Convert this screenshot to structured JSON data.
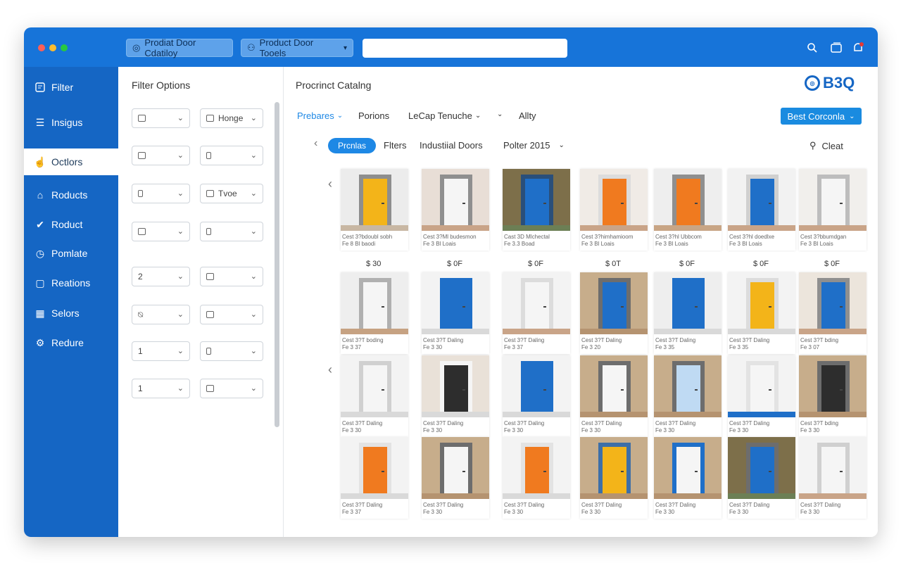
{
  "titlebar": {
    "tab1_label": "Prodiat Door Cdatiloy",
    "tab2_label": "Product Door Tooels",
    "search_value": ""
  },
  "sidebar": {
    "items": [
      {
        "label": "Filter",
        "icon": "filter-icon"
      },
      {
        "label": "Insigus",
        "icon": "list-icon"
      },
      {
        "label": "Octlors",
        "icon": "hand-icon"
      },
      {
        "label": "Roducts",
        "icon": "box-icon"
      },
      {
        "label": "Roduct",
        "icon": "check-icon"
      },
      {
        "label": "Pomlate",
        "icon": "circle-icon"
      },
      {
        "label": "Reations",
        "icon": "square-icon"
      },
      {
        "label": "Selors",
        "icon": "grid-icon"
      },
      {
        "label": "Redure",
        "icon": "gear-icon"
      }
    ],
    "active_index": 2
  },
  "filter_panel": {
    "title": "Filter Options",
    "rows": [
      {
        "left": "",
        "right": "Honge"
      },
      {
        "left": "",
        "right": ""
      },
      {
        "left": "",
        "right": "Tvoe"
      },
      {
        "left": "",
        "right": ""
      },
      {
        "left": "2",
        "right": ""
      },
      {
        "left": "",
        "right": ""
      },
      {
        "left": "1",
        "right": ""
      },
      {
        "left": "1",
        "right": ""
      }
    ]
  },
  "main": {
    "title": "Procrinct Catalng",
    "logo_text": "B3Q",
    "toolbar": {
      "pretares": "Prebares",
      "porions": "Porions",
      "lecap": "LeCap Tenuche",
      "ality": "Allty",
      "best_button": "Best Corconla"
    },
    "filters_row": {
      "pill": "Prcnlas",
      "filters": "Flters",
      "industrial": "Industiial Doors",
      "polter": "Polter 2015",
      "clear": "Cleat"
    },
    "prices_row1": [
      "$ 30",
      "$ 0F",
      "$ 0F",
      "$ 0T",
      "$ 0F",
      "$ 0F",
      "$ 0F"
    ],
    "cards": [
      [
        {
          "door": "#f3b419",
          "frame": "#8e8e8e",
          "wall": "#ececec",
          "floor": "#c8b7a3",
          "caption": "Cest 3?bdoubl sobh\nFe 8 Bl baodi"
        },
        {
          "door": "#f5f5f5",
          "frame": "#8f8f8f",
          "wall": "#e8ded6",
          "floor": "#c9a488",
          "caption": "Cest 3?Ml budesmon\nFe 3 Bl Loais"
        },
        {
          "door": "#1f6fc8",
          "frame": "#2a4f7a",
          "wall": "#7d6f4a",
          "floor": "#6c7f55",
          "caption": "Cast 3D Mlchectal\nFe 3.3 Boad"
        },
        {
          "door": "#f07a1f",
          "frame": "#dcdcdc",
          "wall": "#f0ebe6",
          "floor": "#c9a488",
          "caption": "Cest 3?himhamioom\nFe 3 Bl Loais"
        },
        {
          "door": "#f07a1f",
          "frame": "#8f8f8f",
          "wall": "#eeeeee",
          "floor": "#c8a585",
          "caption": "Cest 3?hl Ubbcom\nFe 3 Bl Loais"
        },
        {
          "door": "#1f6fc8",
          "frame": "#d0d0d0",
          "wall": "#f2f2f2",
          "floor": "#c9a488",
          "caption": "Cest 3?hl doedlxe\nFe 3 Bl Loais"
        },
        {
          "door": "#f5f5f5",
          "frame": "#bdbdbd",
          "wall": "#f1efec",
          "floor": "#c9a488",
          "caption": "Cest 3?bbumdgan\nFe 3 Bl Loais"
        }
      ],
      [
        {
          "door": "#f5f5f5",
          "frame": "#b0b0b0",
          "wall": "#eeeeee",
          "floor": "#c6a282",
          "caption": "Cest 3?T boding\nFe 3 37"
        },
        {
          "door": "#1f6fc8",
          "frame": "#1f6fc8",
          "wall": "#f3f3f3",
          "floor": "#d9d9d9",
          "caption": "Cest 3?T Daling\nFe 3 30"
        },
        {
          "door": "#f5f5f5",
          "frame": "#dcdcdc",
          "wall": "#f3f3f3",
          "floor": "#c9a488",
          "caption": "Cest 3?T Daling\nFe 3 37"
        },
        {
          "door": "#1f6fc8",
          "frame": "#6d6d6d",
          "wall": "#c7ad8b",
          "floor": "#b59370",
          "caption": "Cest 3?T Daling\nFe 3 20"
        },
        {
          "door": "#1f6fc8",
          "frame": "#1f6fc8",
          "wall": "#eeeeee",
          "floor": "#d9d9d9",
          "caption": "Cest 3?T Daling\nFe 3 35"
        },
        {
          "door": "#f3b419",
          "frame": "#dcdcdc",
          "wall": "#f3f3f3",
          "floor": "#d9d9d9",
          "caption": "Cest 3?T Daling\nFe 3 35"
        },
        {
          "door": "#1f6fc8",
          "frame": "#8f8f8f",
          "wall": "#ece5dc",
          "floor": "#c9a488",
          "caption": "Cest 3?T bding\nFe 3 07"
        }
      ],
      [
        {
          "door": "#f5f5f5",
          "frame": "#d0d0d0",
          "wall": "#f3f3f3",
          "floor": "#d9d9d9",
          "caption": "Cest 3?T Daling\nFe 3 30"
        },
        {
          "door": "#2d2d2d",
          "frame": "#f5f5f5",
          "wall": "#e9e1d8",
          "floor": "#d9d9d9",
          "caption": "Cest 3?T Daling\nFe 3 30"
        },
        {
          "door": "#1f6fc8",
          "frame": "#1f6fc8",
          "wall": "#f3f3f3",
          "floor": "#d9d9d9",
          "caption": "Cest 3?T Daling\nFe 3 30"
        },
        {
          "door": "#f5f5f5",
          "frame": "#6d6d6d",
          "wall": "#c7ad8b",
          "floor": "#b59370",
          "caption": "Cest 3?T Daling\nFe 3 30"
        },
        {
          "door": "#bfdaf3",
          "frame": "#6d6d6d",
          "wall": "#c7ad8b",
          "floor": "#b59370",
          "caption": "Cest 3?T Daling\nFe 3 30"
        },
        {
          "door": "#f5f5f5",
          "frame": "#e3e3e3",
          "wall": "#f3f3f3",
          "floor": "#1f6fc8",
          "caption": "Cest 3?T Daling\nFe 3 30"
        },
        {
          "door": "#2d2d2d",
          "frame": "#6d6d6d",
          "wall": "#c7ad8b",
          "floor": "#b59370",
          "caption": "Cest 3?T bding\nFe 3 30"
        }
      ],
      [
        {
          "door": "#f07a1f",
          "frame": "#e3e3e3",
          "wall": "#f3f3f3",
          "floor": "#d9d9d9",
          "caption": "Cest 3?T Daling\nFe 3 37"
        },
        {
          "door": "#f5f5f5",
          "frame": "#6d6d6d",
          "wall": "#c7ad8b",
          "floor": "#b59370",
          "caption": "Cest 3?T Daling\nFe 3 30"
        },
        {
          "door": "#f07a1f",
          "frame": "#e3e3e3",
          "wall": "#f3f3f3",
          "floor": "#d9d9d9",
          "caption": "Cest 3?T Daling\nFe 3 30"
        },
        {
          "door": "#f3b419",
          "frame": "#3d6fa8",
          "wall": "#c7ad8b",
          "floor": "#b59370",
          "caption": "Cest 3?T Daling\nFe 3 30"
        },
        {
          "door": "#f5f5f5",
          "frame": "#1f6fc8",
          "wall": "#c7ad8b",
          "floor": "#b59370",
          "caption": "Cest 3?T Daling\nFe 3 30"
        },
        {
          "door": "#1f6fc8",
          "frame": "#6d6d6d",
          "wall": "#7d6f4a",
          "floor": "#6c7f55",
          "caption": "Cest 3?T Daling\nFe 3 30"
        },
        {
          "door": "#f5f5f5",
          "frame": "#d0d0d0",
          "wall": "#f3f3f3",
          "floor": "#c9a488",
          "caption": "Cest 3?T Daling\nFe 3 30"
        }
      ]
    ]
  }
}
